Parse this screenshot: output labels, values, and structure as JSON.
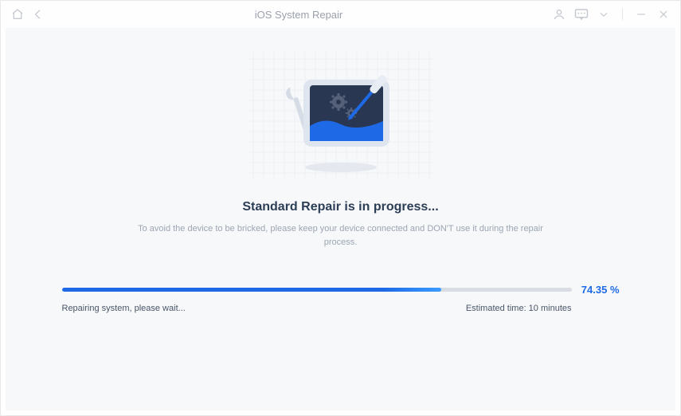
{
  "window": {
    "title": "iOS System Repair"
  },
  "main": {
    "heading": "Standard Repair is in progress...",
    "subtext": "To avoid the device to be bricked, please keep your device connected and DON'T use it during the repair process."
  },
  "progress": {
    "percent_display": "74.35 %",
    "percent_value": 74.35,
    "status": "Repairing system, please wait...",
    "eta": "Estimated time: 10 minutes"
  }
}
